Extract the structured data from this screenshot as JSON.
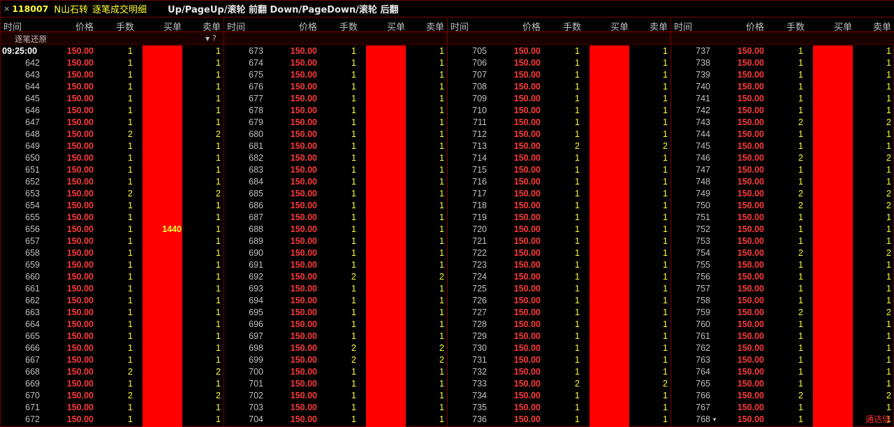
{
  "titlebar": {
    "close": "×",
    "code": "118007",
    "name": "N山石转",
    "title": "逐笔成交明细",
    "hint": "Up/PageUp/滚轮 前翻 Down/PageDown/滚轮 后翻"
  },
  "headers": {
    "time": "时间",
    "price": "价格",
    "lots": "手数",
    "buy": "买单",
    "sell": "卖单"
  },
  "subhead": {
    "label": "逐笔还原",
    "filter_icon": "filter-icon",
    "help_icon": "help-icon"
  },
  "buy_bar_label": "1440",
  "brand": "通达信",
  "colors": {
    "price": "#ff3a3a",
    "buy_bar": "#ff0000",
    "accent": "#ffff30",
    "border": "#7a0000"
  },
  "columns": [
    {
      "rows": [
        {
          "t": "09:25:00",
          "p": "150.00",
          "v": "1",
          "s": "1"
        },
        {
          "t": "642",
          "p": "150.00",
          "v": "1",
          "s": "1"
        },
        {
          "t": "643",
          "p": "150.00",
          "v": "1",
          "s": "1"
        },
        {
          "t": "644",
          "p": "150.00",
          "v": "1",
          "s": "1"
        },
        {
          "t": "645",
          "p": "150.00",
          "v": "1",
          "s": "1"
        },
        {
          "t": "646",
          "p": "150.00",
          "v": "1",
          "s": "1"
        },
        {
          "t": "647",
          "p": "150.00",
          "v": "1",
          "s": "1"
        },
        {
          "t": "648",
          "p": "150.00",
          "v": "2",
          "s": "2"
        },
        {
          "t": "649",
          "p": "150.00",
          "v": "1",
          "s": "1"
        },
        {
          "t": "650",
          "p": "150.00",
          "v": "1",
          "s": "1"
        },
        {
          "t": "651",
          "p": "150.00",
          "v": "1",
          "s": "1"
        },
        {
          "t": "652",
          "p": "150.00",
          "v": "1",
          "s": "1"
        },
        {
          "t": "653",
          "p": "150.00",
          "v": "2",
          "s": "2"
        },
        {
          "t": "654",
          "p": "150.00",
          "v": "1",
          "s": "1"
        },
        {
          "t": "655",
          "p": "150.00",
          "v": "1",
          "s": "1"
        },
        {
          "t": "656",
          "p": "150.00",
          "v": "1",
          "s": "1"
        },
        {
          "t": "657",
          "p": "150.00",
          "v": "1",
          "s": "1"
        },
        {
          "t": "658",
          "p": "150.00",
          "v": "1",
          "s": "1"
        },
        {
          "t": "659",
          "p": "150.00",
          "v": "1",
          "s": "1"
        },
        {
          "t": "660",
          "p": "150.00",
          "v": "1",
          "s": "1"
        },
        {
          "t": "661",
          "p": "150.00",
          "v": "1",
          "s": "1"
        },
        {
          "t": "662",
          "p": "150.00",
          "v": "1",
          "s": "1"
        },
        {
          "t": "663",
          "p": "150.00",
          "v": "1",
          "s": "1"
        },
        {
          "t": "664",
          "p": "150.00",
          "v": "1",
          "s": "1"
        },
        {
          "t": "665",
          "p": "150.00",
          "v": "1",
          "s": "1"
        },
        {
          "t": "666",
          "p": "150.00",
          "v": "1",
          "s": "1"
        },
        {
          "t": "667",
          "p": "150.00",
          "v": "1",
          "s": "1"
        },
        {
          "t": "668",
          "p": "150.00",
          "v": "2",
          "s": "2"
        },
        {
          "t": "669",
          "p": "150.00",
          "v": "1",
          "s": "1"
        },
        {
          "t": "670",
          "p": "150.00",
          "v": "2",
          "s": "2"
        },
        {
          "t": "671",
          "p": "150.00",
          "v": "1",
          "s": "1"
        },
        {
          "t": "672",
          "p": "150.00",
          "v": "1",
          "s": "1"
        }
      ]
    },
    {
      "rows": [
        {
          "t": "673",
          "p": "150.00",
          "v": "1",
          "s": "1"
        },
        {
          "t": "674",
          "p": "150.00",
          "v": "1",
          "s": "1"
        },
        {
          "t": "675",
          "p": "150.00",
          "v": "1",
          "s": "1"
        },
        {
          "t": "676",
          "p": "150.00",
          "v": "1",
          "s": "1"
        },
        {
          "t": "677",
          "p": "150.00",
          "v": "1",
          "s": "1"
        },
        {
          "t": "678",
          "p": "150.00",
          "v": "1",
          "s": "1"
        },
        {
          "t": "679",
          "p": "150.00",
          "v": "1",
          "s": "1"
        },
        {
          "t": "680",
          "p": "150.00",
          "v": "1",
          "s": "1"
        },
        {
          "t": "681",
          "p": "150.00",
          "v": "1",
          "s": "1"
        },
        {
          "t": "682",
          "p": "150.00",
          "v": "1",
          "s": "1"
        },
        {
          "t": "683",
          "p": "150.00",
          "v": "1",
          "s": "1"
        },
        {
          "t": "684",
          "p": "150.00",
          "v": "1",
          "s": "1"
        },
        {
          "t": "685",
          "p": "150.00",
          "v": "1",
          "s": "1"
        },
        {
          "t": "686",
          "p": "150.00",
          "v": "1",
          "s": "1"
        },
        {
          "t": "687",
          "p": "150.00",
          "v": "1",
          "s": "1"
        },
        {
          "t": "688",
          "p": "150.00",
          "v": "1",
          "s": "1"
        },
        {
          "t": "689",
          "p": "150.00",
          "v": "1",
          "s": "1"
        },
        {
          "t": "690",
          "p": "150.00",
          "v": "1",
          "s": "1"
        },
        {
          "t": "691",
          "p": "150.00",
          "v": "1",
          "s": "1"
        },
        {
          "t": "692",
          "p": "150.00",
          "v": "2",
          "s": "2"
        },
        {
          "t": "693",
          "p": "150.00",
          "v": "1",
          "s": "1"
        },
        {
          "t": "694",
          "p": "150.00",
          "v": "1",
          "s": "1"
        },
        {
          "t": "695",
          "p": "150.00",
          "v": "1",
          "s": "1"
        },
        {
          "t": "696",
          "p": "150.00",
          "v": "1",
          "s": "1"
        },
        {
          "t": "697",
          "p": "150.00",
          "v": "1",
          "s": "1"
        },
        {
          "t": "698",
          "p": "150.00",
          "v": "2",
          "s": "2"
        },
        {
          "t": "699",
          "p": "150.00",
          "v": "2",
          "s": "2"
        },
        {
          "t": "700",
          "p": "150.00",
          "v": "1",
          "s": "1"
        },
        {
          "t": "701",
          "p": "150.00",
          "v": "1",
          "s": "1"
        },
        {
          "t": "702",
          "p": "150.00",
          "v": "1",
          "s": "1"
        },
        {
          "t": "703",
          "p": "150.00",
          "v": "1",
          "s": "1"
        },
        {
          "t": "704",
          "p": "150.00",
          "v": "1",
          "s": "1"
        }
      ]
    },
    {
      "rows": [
        {
          "t": "705",
          "p": "150.00",
          "v": "1",
          "s": "1"
        },
        {
          "t": "706",
          "p": "150.00",
          "v": "1",
          "s": "1"
        },
        {
          "t": "707",
          "p": "150.00",
          "v": "1",
          "s": "1"
        },
        {
          "t": "708",
          "p": "150.00",
          "v": "1",
          "s": "1"
        },
        {
          "t": "709",
          "p": "150.00",
          "v": "1",
          "s": "1"
        },
        {
          "t": "710",
          "p": "150.00",
          "v": "1",
          "s": "1"
        },
        {
          "t": "711",
          "p": "150.00",
          "v": "1",
          "s": "1"
        },
        {
          "t": "712",
          "p": "150.00",
          "v": "1",
          "s": "1"
        },
        {
          "t": "713",
          "p": "150.00",
          "v": "2",
          "s": "2"
        },
        {
          "t": "714",
          "p": "150.00",
          "v": "1",
          "s": "1"
        },
        {
          "t": "715",
          "p": "150.00",
          "v": "1",
          "s": "1"
        },
        {
          "t": "716",
          "p": "150.00",
          "v": "1",
          "s": "1"
        },
        {
          "t": "717",
          "p": "150.00",
          "v": "1",
          "s": "1"
        },
        {
          "t": "718",
          "p": "150.00",
          "v": "1",
          "s": "1"
        },
        {
          "t": "719",
          "p": "150.00",
          "v": "1",
          "s": "1"
        },
        {
          "t": "720",
          "p": "150.00",
          "v": "1",
          "s": "1"
        },
        {
          "t": "721",
          "p": "150.00",
          "v": "1",
          "s": "1"
        },
        {
          "t": "722",
          "p": "150.00",
          "v": "1",
          "s": "1"
        },
        {
          "t": "723",
          "p": "150.00",
          "v": "1",
          "s": "1"
        },
        {
          "t": "724",
          "p": "150.00",
          "v": "1",
          "s": "1"
        },
        {
          "t": "725",
          "p": "150.00",
          "v": "1",
          "s": "1"
        },
        {
          "t": "726",
          "p": "150.00",
          "v": "1",
          "s": "1"
        },
        {
          "t": "727",
          "p": "150.00",
          "v": "1",
          "s": "1"
        },
        {
          "t": "728",
          "p": "150.00",
          "v": "1",
          "s": "1"
        },
        {
          "t": "729",
          "p": "150.00",
          "v": "1",
          "s": "1"
        },
        {
          "t": "730",
          "p": "150.00",
          "v": "1",
          "s": "1"
        },
        {
          "t": "731",
          "p": "150.00",
          "v": "1",
          "s": "1"
        },
        {
          "t": "732",
          "p": "150.00",
          "v": "1",
          "s": "1"
        },
        {
          "t": "733",
          "p": "150.00",
          "v": "2",
          "s": "2"
        },
        {
          "t": "734",
          "p": "150.00",
          "v": "1",
          "s": "1"
        },
        {
          "t": "735",
          "p": "150.00",
          "v": "1",
          "s": "1"
        },
        {
          "t": "736",
          "p": "150.00",
          "v": "1",
          "s": "1"
        }
      ]
    },
    {
      "rows": [
        {
          "t": "737",
          "p": "150.00",
          "v": "1",
          "s": "1"
        },
        {
          "t": "738",
          "p": "150.00",
          "v": "1",
          "s": "1"
        },
        {
          "t": "739",
          "p": "150.00",
          "v": "1",
          "s": "1"
        },
        {
          "t": "740",
          "p": "150.00",
          "v": "1",
          "s": "1"
        },
        {
          "t": "741",
          "p": "150.00",
          "v": "1",
          "s": "1"
        },
        {
          "t": "742",
          "p": "150.00",
          "v": "1",
          "s": "1"
        },
        {
          "t": "743",
          "p": "150.00",
          "v": "2",
          "s": "2"
        },
        {
          "t": "744",
          "p": "150.00",
          "v": "1",
          "s": "1"
        },
        {
          "t": "745",
          "p": "150.00",
          "v": "1",
          "s": "1"
        },
        {
          "t": "746",
          "p": "150.00",
          "v": "2",
          "s": "2"
        },
        {
          "t": "747",
          "p": "150.00",
          "v": "1",
          "s": "1"
        },
        {
          "t": "748",
          "p": "150.00",
          "v": "1",
          "s": "1"
        },
        {
          "t": "749",
          "p": "150.00",
          "v": "2",
          "s": "2"
        },
        {
          "t": "750",
          "p": "150.00",
          "v": "2",
          "s": "2"
        },
        {
          "t": "751",
          "p": "150.00",
          "v": "1",
          "s": "1"
        },
        {
          "t": "752",
          "p": "150.00",
          "v": "1",
          "s": "1"
        },
        {
          "t": "753",
          "p": "150.00",
          "v": "1",
          "s": "1"
        },
        {
          "t": "754",
          "p": "150.00",
          "v": "2",
          "s": "2"
        },
        {
          "t": "755",
          "p": "150.00",
          "v": "1",
          "s": "1"
        },
        {
          "t": "756",
          "p": "150.00",
          "v": "1",
          "s": "1"
        },
        {
          "t": "757",
          "p": "150.00",
          "v": "1",
          "s": "1"
        },
        {
          "t": "758",
          "p": "150.00",
          "v": "1",
          "s": "1"
        },
        {
          "t": "759",
          "p": "150.00",
          "v": "2",
          "s": "2"
        },
        {
          "t": "760",
          "p": "150.00",
          "v": "1",
          "s": "1"
        },
        {
          "t": "761",
          "p": "150.00",
          "v": "1",
          "s": "1"
        },
        {
          "t": "762",
          "p": "150.00",
          "v": "1",
          "s": "1"
        },
        {
          "t": "763",
          "p": "150.00",
          "v": "1",
          "s": "1"
        },
        {
          "t": "764",
          "p": "150.00",
          "v": "1",
          "s": "1"
        },
        {
          "t": "765",
          "p": "150.00",
          "v": "1",
          "s": "1"
        },
        {
          "t": "766",
          "p": "150.00",
          "v": "2",
          "s": "2"
        },
        {
          "t": "767",
          "p": "150.00",
          "v": "1",
          "s": "1"
        },
        {
          "t": "768",
          "p": "150.00",
          "v": "1",
          "s": "1"
        }
      ]
    }
  ]
}
